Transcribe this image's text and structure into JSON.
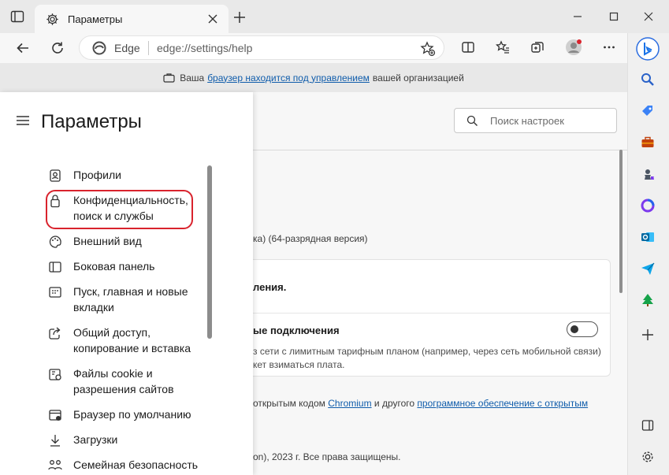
{
  "tab": {
    "title": "Параметры"
  },
  "address": {
    "edge_label": "Edge",
    "url": "edge://settings/help"
  },
  "managed_bar": {
    "prefix": "Ваша",
    "link": "браузер находится под управлением",
    "suffix": "вашей организацией"
  },
  "settings": {
    "title": "Параметры",
    "search_placeholder": "Поиск настроек",
    "nav": [
      {
        "label": "Профили",
        "icon": "profile-icon"
      },
      {
        "label": "Конфиденциальность, поиск и службы",
        "icon": "lock-icon"
      },
      {
        "label": "Внешний вид",
        "icon": "palette-icon"
      },
      {
        "label": "Боковая панель",
        "icon": "sidebar-icon"
      },
      {
        "label": "Пуск, главная и новые вкладки",
        "icon": "tab-icon"
      },
      {
        "label": "Общий доступ, копирование и вставка",
        "icon": "share-icon"
      },
      {
        "label": "Файлы cookie и разрешения сайтов",
        "icon": "cookie-icon"
      },
      {
        "label": "Браузер по умолчанию",
        "icon": "browser-icon"
      },
      {
        "label": "Загрузки",
        "icon": "download-icon"
      },
      {
        "label": "Семейная безопасность",
        "icon": "family-icon"
      }
    ]
  },
  "content": {
    "version_text": "ка) (64-разрядная версия)",
    "card_line1": "ления.",
    "card_line2": "ые подключения",
    "card_desc1": "з сети с лимитным тарифным планом (например, через сеть мобильной связи)",
    "card_desc2": "кет взиматься плата.",
    "about_prefix": "открытым кодом",
    "about_link1": "Chromium",
    "about_mid": "и другого",
    "about_link2": "программное обеспечение с открытым",
    "copyright": "on), 2023 г. Все права защищены."
  },
  "colors": {
    "accent": "#0f5cab",
    "highlight": "#d9232d"
  }
}
